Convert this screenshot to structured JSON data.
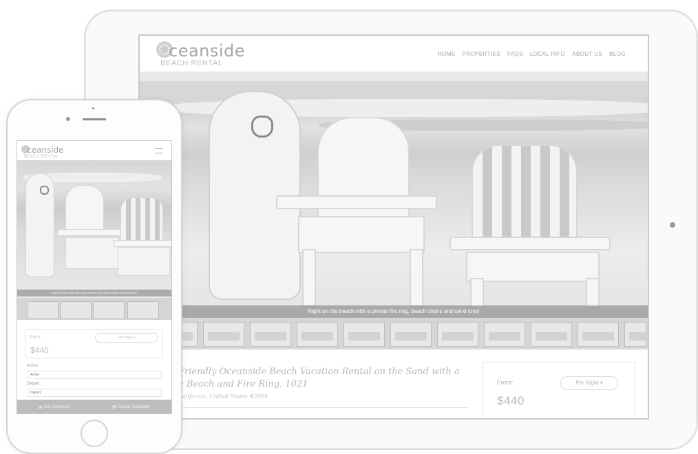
{
  "brand": {
    "word": "ceanside",
    "subtitle": "BEACH RENTAL",
    "mark_icon": "shell-logo-icon"
  },
  "nav": {
    "items": [
      "HOME",
      "PROPERTIES",
      "FAQS",
      "LOCAL INFO",
      "ABOUT US",
      "BLOG"
    ]
  },
  "hero": {
    "caption": "Right on the beach with a private fire ring, beach chairs and sand toys!"
  },
  "listing": {
    "title_line1": "Friendly Oceanside Beach Vacation Rental on the Sand with a",
    "title_line2": "e Beach and Fire Ring, 1021",
    "location": "California, United States #2054"
  },
  "pricing": {
    "from_label": "From:",
    "per_night_label": "Per Night ▾",
    "price": "$440"
  },
  "mobile": {
    "brand_word": "ceanside",
    "brand_subtitle": "BEACH RENTAL",
    "caption": "Right on the beach with a private fire ring, beach chairs and sand toys!",
    "from_label": "From:",
    "per_night_label": "Per Night ▾",
    "price": "$440",
    "arrive_label": "Arrive:",
    "arrive_placeholder": "Arrive",
    "depart_label": "Depart:",
    "depart_placeholder": "Depart",
    "footer": {
      "ask_label": "Ask Questions",
      "check_label": "Check Availability"
    }
  }
}
